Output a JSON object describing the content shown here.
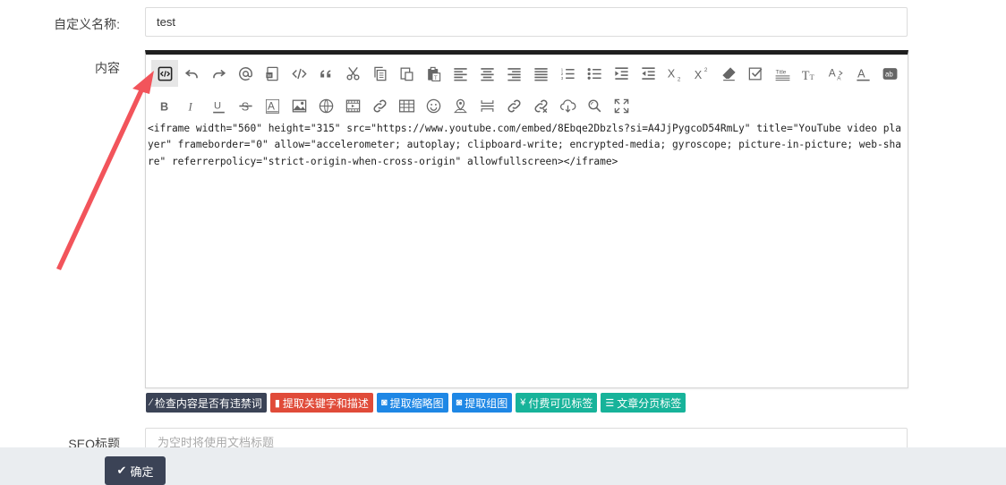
{
  "form": {
    "custom_name_label": "自定义名称:",
    "custom_name_value": "test",
    "content_label": "内容",
    "seo_title_label": "SEO标题",
    "seo_title_placeholder": "为空时将使用文档标题"
  },
  "toolbar": {
    "row1": [
      "source-code-icon",
      "undo-icon",
      "redo-icon",
      "at-icon",
      "word-import-icon",
      "code-icon",
      "blockquote-icon",
      "cut-icon",
      "copy-icon",
      "paste-icon",
      "paste-text-icon",
      "align-left-icon",
      "align-center-icon",
      "align-right-icon",
      "align-justify-icon",
      "ordered-list-icon",
      "unordered-list-icon",
      "indent-icon",
      "outdent-icon",
      "subscript-icon",
      "superscript-icon",
      "clear-format-icon",
      "select-all-icon",
      "title-icon",
      "font-size-icon",
      "text-scale-icon",
      "font-color-icon",
      "background-color-icon"
    ],
    "row2": [
      "bold-icon",
      "italic-icon",
      "underline-icon",
      "strikethrough-icon",
      "text-style-icon",
      "image-icon",
      "globe-image-icon",
      "video-icon",
      "link-icon",
      "table-icon",
      "emoji-icon",
      "map-icon",
      "horizontal-rule-icon",
      "insert-link-icon",
      "unlink-icon",
      "cloud-download-icon",
      "search-replace-icon",
      "fullscreen-icon"
    ]
  },
  "editor": {
    "source_html": "<iframe width=\"560\" height=\"315\" src=\"https://www.youtube.com/embed/8Ebqe2Dbzls?si=A4JjPygcoD54RmLy\" title=\"YouTube video player\" frameborder=\"0\" allow=\"accelerometer; autoplay; clipboard-write; encrypted-media; gyroscope; picture-in-picture; web-share\" referrerpolicy=\"strict-origin-when-cross-origin\" allowfullscreen></iframe>"
  },
  "actions": [
    {
      "label": "检查内容是否有违禁词",
      "icon": "wand-icon",
      "color": "#3b4356"
    },
    {
      "label": "提取关键字和描述",
      "icon": "file-icon",
      "color": "#e04b39"
    },
    {
      "label": "提取缩略图",
      "icon": "camera-icon",
      "color": "#1e87e5"
    },
    {
      "label": "提取组图",
      "icon": "camera-icon",
      "color": "#1e87e5"
    },
    {
      "label": "付费可见标签",
      "icon": "yen-icon",
      "color": "#17b39a"
    },
    {
      "label": "文章分页标签",
      "icon": "list-icon",
      "color": "#17b39a"
    }
  ],
  "footer": {
    "confirm_label": "确定"
  },
  "colors": {
    "arrow": "#f2545b",
    "editor_top_border": "#1f1f1f",
    "footer_bg": "#eaedf0"
  }
}
